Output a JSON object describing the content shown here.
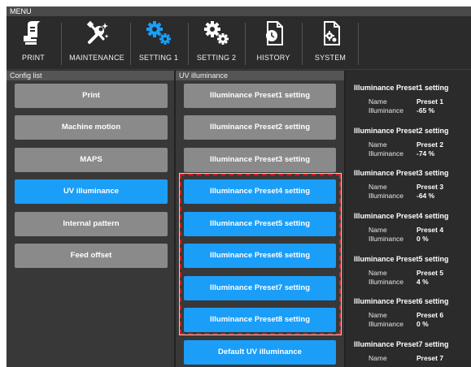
{
  "menu_label": "MENU",
  "toolbar": [
    {
      "label": "PRINT",
      "icon": "print-icon"
    },
    {
      "label": "MAINTENANCE",
      "icon": "maintenance-tools-icon"
    },
    {
      "label": "SETTING 1",
      "icon": "gears-blue-icon"
    },
    {
      "label": "SETTING 2",
      "icon": "gears-white-icon"
    },
    {
      "label": "HISTORY",
      "icon": "history-document-icon"
    },
    {
      "label": "SYSTEM",
      "icon": "system-document-icon"
    }
  ],
  "config_list": {
    "header": "Config list",
    "items": [
      {
        "label": "Print",
        "state": "normal"
      },
      {
        "label": "Machine motion",
        "state": "normal"
      },
      {
        "label": "MAPS",
        "state": "normal"
      },
      {
        "label": "UV illuminance",
        "state": "selected"
      },
      {
        "label": "Internal pattern",
        "state": "normal"
      },
      {
        "label": "Feed offset",
        "state": "normal"
      }
    ]
  },
  "uv": {
    "header": "UV illuminance",
    "items": [
      {
        "label": "Illuminance Preset1 setting",
        "state": "normal"
      },
      {
        "label": "Illuminance Preset2 setting",
        "state": "normal"
      },
      {
        "label": "Illuminance Preset3 setting",
        "state": "normal"
      },
      {
        "label": "Illuminance Preset4 setting",
        "state": "selected"
      },
      {
        "label": "Illuminance Preset5 setting",
        "state": "selected"
      },
      {
        "label": "Illuminance Preset6 setting",
        "state": "selected"
      },
      {
        "label": "Illuminance Preset7 setting",
        "state": "selected"
      },
      {
        "label": "Illuminance Preset8 setting",
        "state": "selected"
      },
      {
        "label": "Default UV illuminance",
        "state": "selected"
      }
    ]
  },
  "presets": [
    {
      "title": "Illuminance Preset1 setting",
      "name_key": "Name",
      "name": "Preset 1",
      "ill_key": "Illuminance",
      "ill": "-65 %"
    },
    {
      "title": "Illuminance Preset2 setting",
      "name_key": "Name",
      "name": "Preset 2",
      "ill_key": "Illuminance",
      "ill": "-74 %"
    },
    {
      "title": "Illuminance Preset3 setting",
      "name_key": "Name",
      "name": "Preset 3",
      "ill_key": "Illuminance",
      "ill": "-64 %"
    },
    {
      "title": "Illuminance Preset4 setting",
      "name_key": "Name",
      "name": "Preset 4",
      "ill_key": "Illuminance",
      "ill": "0 %"
    },
    {
      "title": "Illuminance Preset5 setting",
      "name_key": "Name",
      "name": "Preset 5",
      "ill_key": "Illuminance",
      "ill": "4 %"
    },
    {
      "title": "Illuminance Preset6 setting",
      "name_key": "Name",
      "name": "Preset 6",
      "ill_key": "Illuminance",
      "ill": "0 %"
    },
    {
      "title": "Illuminance Preset7 setting",
      "name_key": "Name",
      "name": "Preset 7",
      "ill_key": "Illuminance",
      "ill": ""
    }
  ],
  "colors": {
    "accent": "#1a9ef8",
    "button_gray": "#8a8a8a",
    "highlight": "#d42020",
    "background": "#2b2b2b"
  }
}
